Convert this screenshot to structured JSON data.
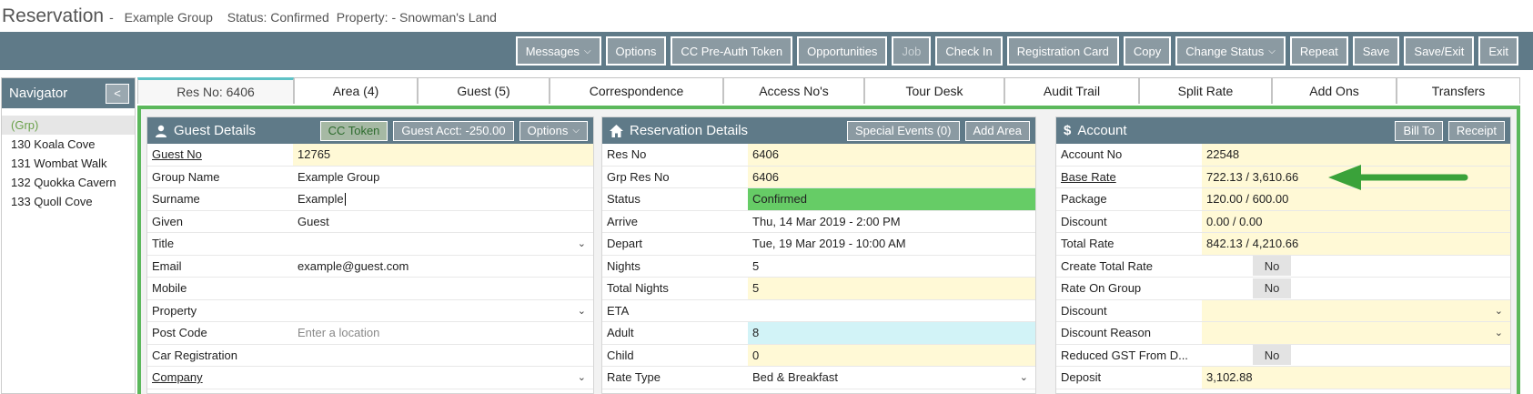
{
  "title": {
    "main": "Reservation",
    "sep": "-",
    "group": "Example Group",
    "status": "Status: Confirmed",
    "property": "Property: - Snowman's Land"
  },
  "toolbar": {
    "messages": "Messages",
    "options": "Options",
    "cc_preauth": "CC Pre-Auth Token",
    "opportunities": "Opportunities",
    "job": "Job",
    "check_in": "Check In",
    "registration_card": "Registration Card",
    "copy": "Copy",
    "change_status": "Change Status",
    "repeat": "Repeat",
    "save": "Save",
    "save_exit": "Save/Exit",
    "exit": "Exit"
  },
  "navigator": {
    "title": "Navigator",
    "collapse": "<",
    "items": [
      "(Grp)",
      "130 Koala Cove",
      "131 Wombat Walk",
      "132 Quokka Cavern",
      "133 Quoll Cove"
    ]
  },
  "tabs": [
    "Res No: 6406",
    "Area (4)",
    "Guest (5)",
    "Correspondence",
    "Access No's",
    "Tour Desk",
    "Audit Trail",
    "Split Rate",
    "Add Ons",
    "Transfers"
  ],
  "guest": {
    "title": "Guest Details",
    "cc_token": "CC Token",
    "guest_acct": "Guest Acct: -250.00",
    "options": "Options",
    "rows": [
      {
        "label": "Guest No",
        "value": "12765"
      },
      {
        "label": "Group Name",
        "value": "Example Group"
      },
      {
        "label": "Surname",
        "value": "Example"
      },
      {
        "label": "Given",
        "value": "Guest"
      },
      {
        "label": "Title",
        "value": ""
      },
      {
        "label": "Email",
        "value": "example@guest.com"
      },
      {
        "label": "Mobile",
        "value": ""
      },
      {
        "label": "Property",
        "value": ""
      },
      {
        "label": "Post Code",
        "value": "Enter a location"
      },
      {
        "label": "Car Registration",
        "value": ""
      },
      {
        "label": "Company",
        "value": ""
      }
    ]
  },
  "reservation": {
    "title": "Reservation Details",
    "special_events": "Special Events (0)",
    "add_area": "Add Area",
    "rows": [
      {
        "label": "Res No",
        "value": "6406"
      },
      {
        "label": "Grp Res No",
        "value": "6406"
      },
      {
        "label": "Status",
        "value": "Confirmed"
      },
      {
        "label": "Arrive",
        "value": "Thu, 14 Mar 2019 - 2:00 PM"
      },
      {
        "label": "Depart",
        "value": "Tue, 19 Mar 2019 - 10:00 AM"
      },
      {
        "label": "Nights",
        "value": "5"
      },
      {
        "label": "Total Nights",
        "value": "5"
      },
      {
        "label": "ETA",
        "value": ""
      },
      {
        "label": "Adult",
        "value": "8"
      },
      {
        "label": "Child",
        "value": "0"
      },
      {
        "label": "Rate Type",
        "value": "Bed & Breakfast"
      }
    ]
  },
  "account": {
    "title": "Account",
    "bill_to": "Bill To",
    "receipt": "Receipt",
    "rows": [
      {
        "label": "Account No",
        "value": "22548"
      },
      {
        "label": "Base Rate",
        "value": "722.13 / 3,610.66"
      },
      {
        "label": "Package",
        "value": "120.00 / 600.00"
      },
      {
        "label": "Discount",
        "value": "0.00 / 0.00"
      },
      {
        "label": "Total Rate",
        "value": "842.13 / 4,210.66"
      },
      {
        "label": "Create Total Rate",
        "value": "No"
      },
      {
        "label": "Rate On Group",
        "value": "No"
      },
      {
        "label": "Discount",
        "value": ""
      },
      {
        "label": "Discount Reason",
        "value": ""
      },
      {
        "label": "Reduced GST From D...",
        "value": "No"
      },
      {
        "label": "Deposit",
        "value": "3,102.88"
      }
    ]
  },
  "colors": {
    "toolbar": "#5f7a88",
    "frame": "#5cb85c",
    "status_green": "#66cc66",
    "field_yellow": "#fff9d6",
    "arrow": "#3aa23a"
  }
}
